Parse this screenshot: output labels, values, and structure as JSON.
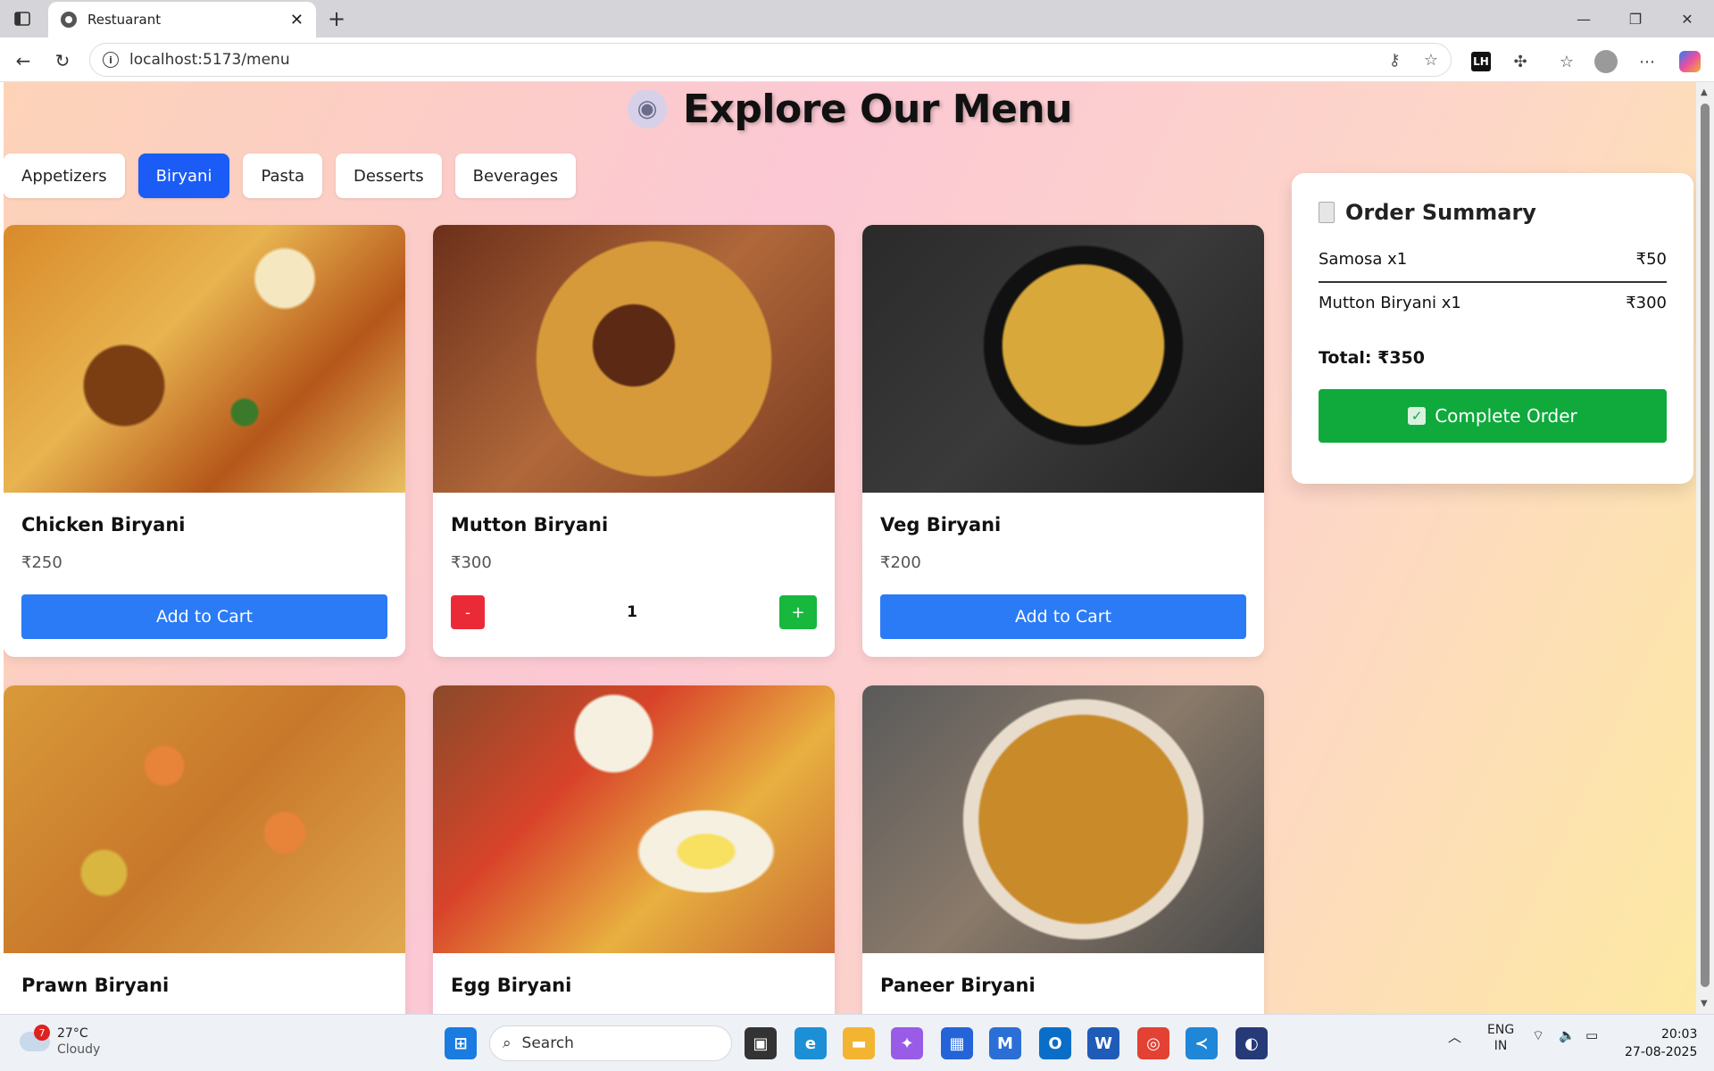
{
  "browser": {
    "tab_title": "Restuarant",
    "url": "localhost:5173/menu"
  },
  "page": {
    "title": "Explore Our Menu",
    "categories": [
      {
        "label": "Appetizers",
        "active": false
      },
      {
        "label": "Biryani",
        "active": true
      },
      {
        "label": "Pasta",
        "active": false
      },
      {
        "label": "Desserts",
        "active": false
      },
      {
        "label": "Beverages",
        "active": false
      }
    ],
    "items": [
      {
        "name": "Chicken Biryani",
        "price": "₹250",
        "button": "Add to Cart"
      },
      {
        "name": "Mutton Biryani",
        "price": "₹300",
        "minus": "-",
        "quantity": "1",
        "plus": "+"
      },
      {
        "name": "Veg Biryani",
        "price": "₹200",
        "button": "Add to Cart"
      },
      {
        "name": "Prawn Biryani"
      },
      {
        "name": "Egg Biryani"
      },
      {
        "name": "Paneer Biryani"
      }
    ]
  },
  "order_summary": {
    "title": "Order Summary",
    "lines": [
      {
        "item": "Samosa x1",
        "price": "₹50"
      },
      {
        "item": "Mutton Biryani x1",
        "price": "₹300"
      }
    ],
    "total": "Total: ₹350",
    "button": "Complete Order"
  },
  "taskbar": {
    "weather_temp": "27°C",
    "weather_desc": "Cloudy",
    "weather_badge": "7",
    "search_placeholder": "Search",
    "lang_top": "ENG",
    "lang_bottom": "IN",
    "time": "20:03",
    "date": "27-08-2025"
  },
  "colors": {
    "accent_blue": "#2b7bf6",
    "active_tab": "#1a5cf5",
    "complete_green": "#0fa93c",
    "minus_red": "#ea2b37",
    "plus_green": "#18b83f"
  }
}
